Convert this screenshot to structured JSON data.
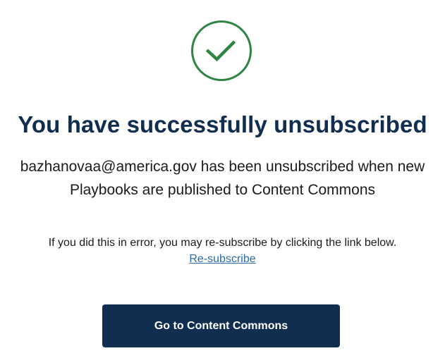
{
  "status_icon": {
    "name": "check-circle-icon",
    "color": "#2e8540"
  },
  "title": "You have successfully unsubscribed",
  "message": {
    "line1": "bazhanovaa@america.gov has been unsubscribed when new",
    "line2": "Playbooks are published to Content Commons"
  },
  "error_note": {
    "text": "If you did this in error, you may re-subscribe by clicking the link below.",
    "link_label": "Re-subscribe"
  },
  "cta": {
    "label": "Go to Content Commons"
  },
  "colors": {
    "primary": "#112e51",
    "link": "#2e6ba8",
    "success": "#2e8540"
  }
}
